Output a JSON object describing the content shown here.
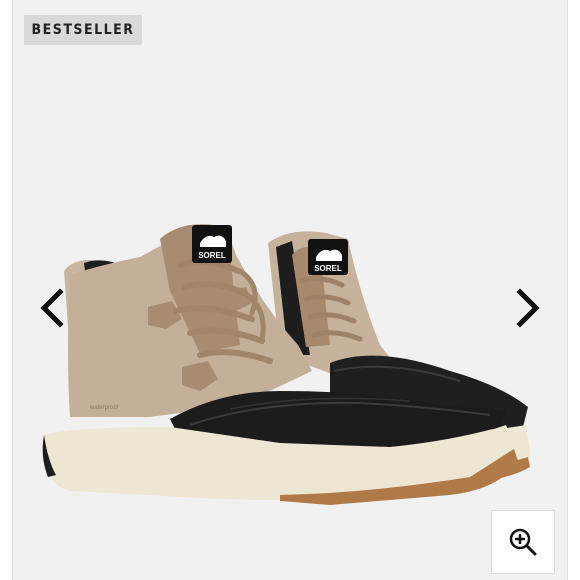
{
  "badge": {
    "label": "BESTSELLER"
  },
  "product": {
    "logo_text": "SOREL",
    "side_text": "waterproof"
  },
  "navigation": {
    "prev_icon": "chevron-left-icon",
    "next_icon": "chevron-right-icon",
    "zoom_icon": "zoom-in-icon"
  },
  "colors": {
    "background": "#f1f1f1",
    "badge_bg": "#d9d9d9",
    "suede": "#c2ad96",
    "suede_dark": "#a88c71",
    "rubber": "#1d1d1d",
    "sole": "#ece6d3",
    "gum": "#b07a48"
  }
}
